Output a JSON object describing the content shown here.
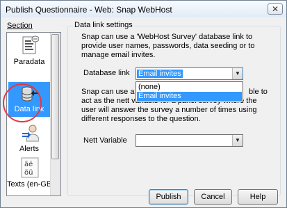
{
  "window": {
    "title": "Publish Questionnaire - Web: Snap WebHost",
    "close_glyph": "✕"
  },
  "section": {
    "label": "Section",
    "items": [
      {
        "label": "Paradata",
        "icon": "clipboard-icon"
      },
      {
        "label": "Data link",
        "icon": "database-link-icon",
        "selected": true
      },
      {
        "label": "Alerts",
        "icon": "alert-person-icon"
      },
      {
        "label": "Texts (en-GB)",
        "icon": "text-characters-icon"
      }
    ]
  },
  "group": {
    "title": "Data link settings",
    "para1": "Snap can use a 'WebHost Survey' database link to provide user names, passwords, data seeding or to manage email invites.",
    "para2_visible_start": "Snap can use a",
    "para2_visible_end": "ble to",
    "para2_line2": "act as the nett variable for a panel survey where the",
    "para2_line3": "user will answer the survey a number of times using",
    "para2_line4": "different responses to the question.",
    "database_link": {
      "label": "Database link",
      "value": "Email invites",
      "options": [
        "(none)",
        "Email invites"
      ],
      "selected_index": 1
    },
    "nett_variable": {
      "label": "Nett Variable",
      "value": ""
    }
  },
  "buttons": {
    "publish": "Publish",
    "cancel": "Cancel",
    "help": "Help"
  }
}
